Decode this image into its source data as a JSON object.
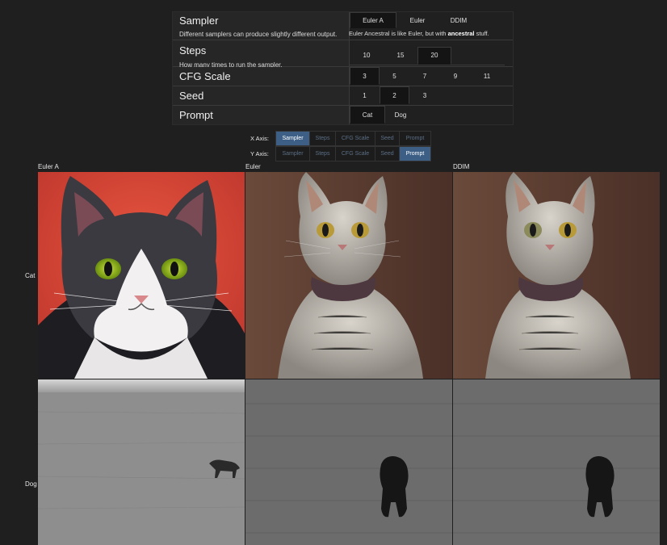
{
  "params": {
    "sampler": {
      "name": "Sampler",
      "description": "Different samplers can produce slightly different output.",
      "options": [
        "Euler A",
        "Euler",
        "DDIM"
      ],
      "selected": "Euler A",
      "note_prefix": "Euler Ancestral is like Euler, but with ",
      "note_bold": "ancestral",
      "note_suffix": " stuff."
    },
    "steps": {
      "name": "Steps",
      "description": "How many times to run the sampler.",
      "options": [
        "10",
        "15",
        "20"
      ],
      "selected": "20"
    },
    "cfg": {
      "name": "CFG Scale",
      "options": [
        "3",
        "5",
        "7",
        "9",
        "11"
      ],
      "selected": "3"
    },
    "seed": {
      "name": "Seed",
      "options": [
        "1",
        "2",
        "3"
      ],
      "selected": "2"
    },
    "prompt": {
      "name": "Prompt",
      "options": [
        "Cat",
        "Dog"
      ],
      "selected": "Cat"
    }
  },
  "axes": {
    "x_label": "X Axis:",
    "y_label": "Y Axis:",
    "buttons": [
      "Sampler",
      "Steps",
      "CFG Scale",
      "Seed",
      "Prompt"
    ],
    "x_selected": "Sampler",
    "y_selected": "Prompt"
  },
  "grid": {
    "columns": [
      "Euler A",
      "Euler",
      "DDIM"
    ],
    "rows": [
      "Cat",
      "Dog"
    ]
  },
  "colors": {
    "active_axis": "#3d5f86",
    "inactive_axis_text": "#5b6f86",
    "background": "#1f1f1f"
  }
}
